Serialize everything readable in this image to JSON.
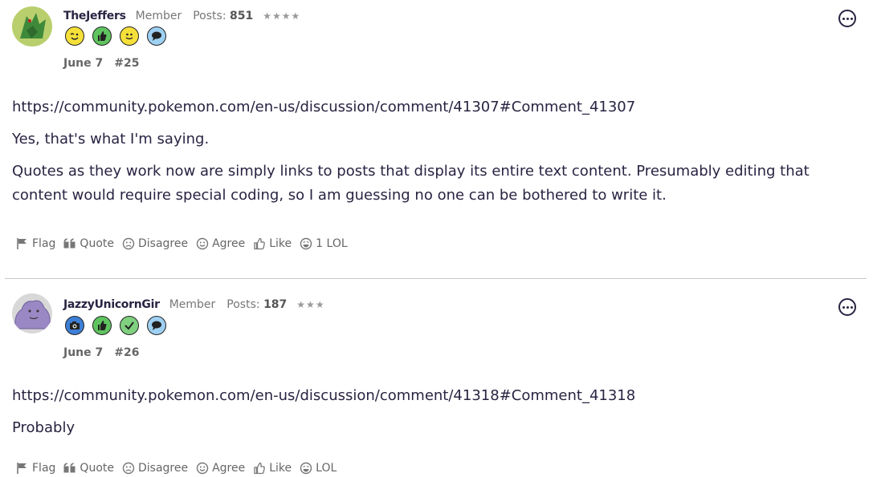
{
  "posts": [
    {
      "username": "TheJeffers",
      "role": "Member",
      "posts_label": "Posts:",
      "posts_count": "851",
      "stars": "★★★★",
      "date": "June 7",
      "number": "#25",
      "paragraphs": [
        "https://community.pokemon.com/en-us/discussion/comment/41307#Comment_41307",
        "Yes, that's what I'm saying.",
        "Quotes as they work now are simply links to posts that display its entire text content. Presumably editing that content would require special coding, so I am guessing no one can be bothered to write it."
      ],
      "actions": {
        "flag": "Flag",
        "quote": "Quote",
        "disagree": "Disagree",
        "agree": "Agree",
        "like": "Like",
        "lol": "1 LOL"
      }
    },
    {
      "username": "JazzyUnicornGir",
      "role": "Member",
      "posts_label": "Posts:",
      "posts_count": "187",
      "stars": "★★★",
      "date": "June 7",
      "number": "#26",
      "paragraphs": [
        "https://community.pokemon.com/en-us/discussion/comment/41318#Comment_41318",
        "Probably"
      ],
      "actions": {
        "flag": "Flag",
        "quote": "Quote",
        "disagree": "Disagree",
        "agree": "Agree",
        "like": "Like",
        "lol": "LOL"
      }
    }
  ],
  "colors": {
    "text": "#2a2342",
    "muted": "#777777",
    "badge_yellow": "#f5e03a",
    "badge_green": "#5fc45f",
    "badge_blue": "#9ed0f2",
    "badge_camera": "#3d7fd6"
  }
}
